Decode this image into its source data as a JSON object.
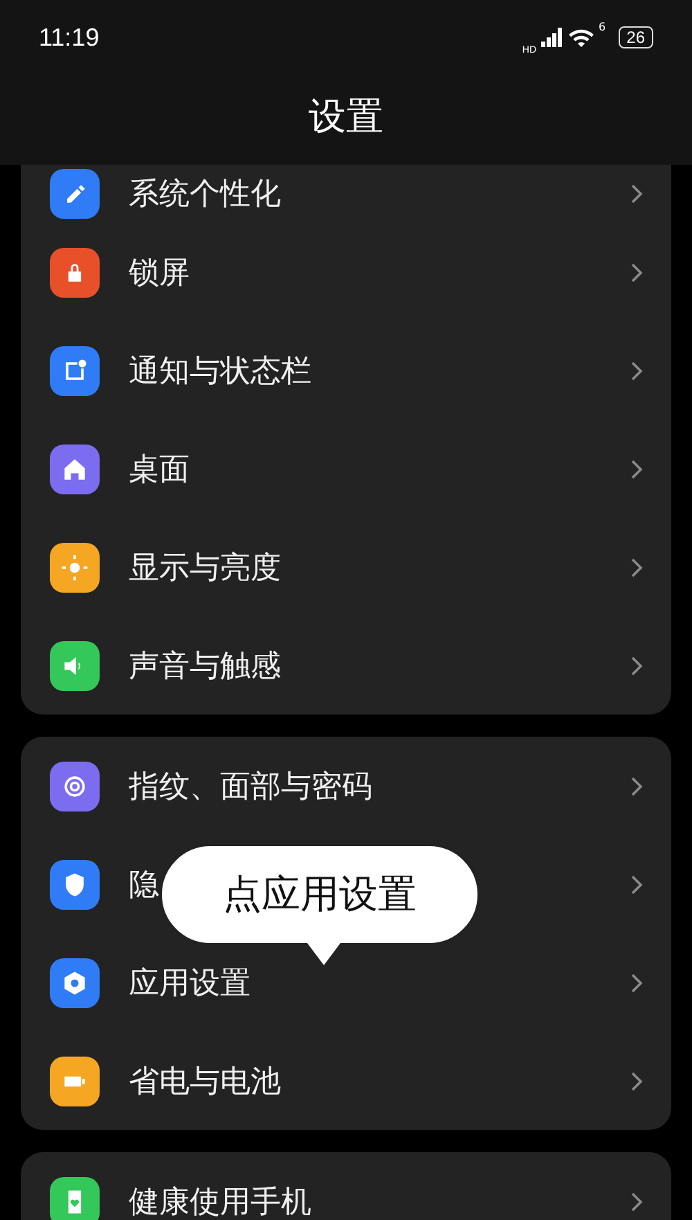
{
  "status_bar": {
    "time": "11:19",
    "network_label": "HD",
    "wifi_label": "6",
    "battery": "26"
  },
  "header": {
    "title": "设置"
  },
  "sections": [
    {
      "items": [
        {
          "label": "系统个性化",
          "color": "#2f7cf6"
        },
        {
          "label": "锁屏",
          "color": "#e8502a"
        },
        {
          "label": "通知与状态栏",
          "color": "#2f7cf6"
        },
        {
          "label": "桌面",
          "color": "#7b6cf0"
        },
        {
          "label": "显示与亮度",
          "color": "#f5a623"
        },
        {
          "label": "声音与触感",
          "color": "#34c759"
        }
      ]
    },
    {
      "items": [
        {
          "label": "指纹、面部与密码",
          "color": "#7b6cf0"
        },
        {
          "label": "隐",
          "color": "#2f7cf6"
        },
        {
          "label": "应用设置",
          "color": "#2f7cf6"
        },
        {
          "label": "省电与电池",
          "color": "#f5a623"
        }
      ]
    },
    {
      "items": [
        {
          "label": "健康使用手机",
          "color": "#34c759"
        }
      ]
    }
  ],
  "tooltip": {
    "text": "点应用设置"
  }
}
